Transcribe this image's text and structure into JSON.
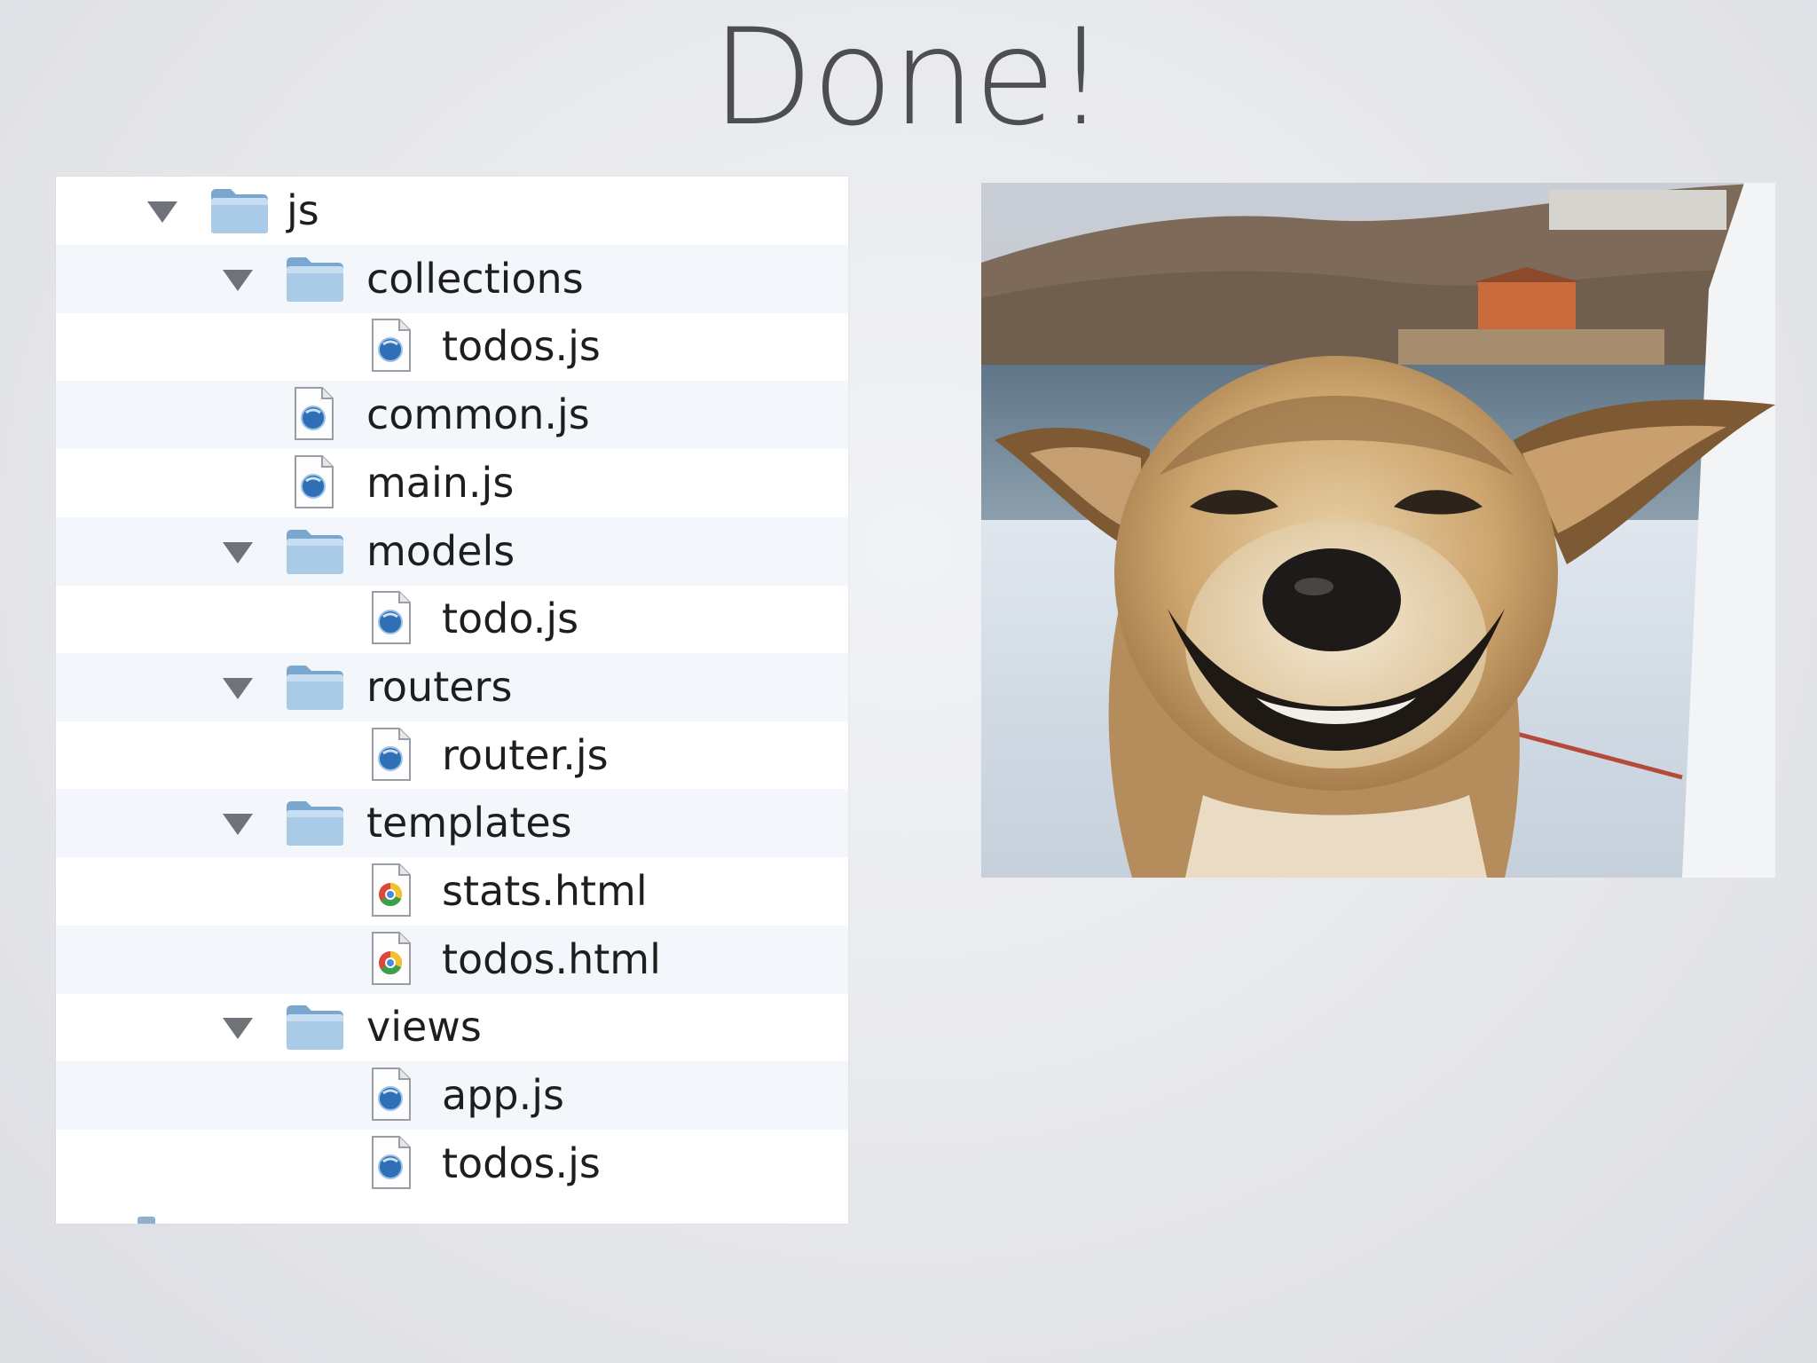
{
  "slide": {
    "title": "Done!"
  },
  "tree": {
    "rows": [
      {
        "label": "js",
        "kind": "folder",
        "level": 0
      },
      {
        "label": "collections",
        "kind": "folder",
        "level": 1
      },
      {
        "label": "todos.js",
        "kind": "js-file",
        "level": 2
      },
      {
        "label": "common.js",
        "kind": "js-file",
        "level": 1
      },
      {
        "label": "main.js",
        "kind": "js-file",
        "level": 1
      },
      {
        "label": "models",
        "kind": "folder",
        "level": 1
      },
      {
        "label": "todo.js",
        "kind": "js-file",
        "level": 2
      },
      {
        "label": "routers",
        "kind": "folder",
        "level": 1
      },
      {
        "label": "router.js",
        "kind": "js-file",
        "level": 2
      },
      {
        "label": "templates",
        "kind": "folder",
        "level": 1
      },
      {
        "label": "stats.html",
        "kind": "html-file",
        "level": 2
      },
      {
        "label": "todos.html",
        "kind": "html-file",
        "level": 2
      },
      {
        "label": "views",
        "kind": "folder",
        "level": 1
      },
      {
        "label": "app.js",
        "kind": "js-file",
        "level": 2
      },
      {
        "label": "todos.js",
        "kind": "js-file",
        "level": 2
      }
    ],
    "icons": {
      "folder": "folder-icon",
      "js-file": "javascript-file-icon",
      "html-file": "html-file-icon",
      "disclosure": "disclosure-triangle-icon"
    }
  },
  "photo": {
    "subject": "smiling-dog-photo"
  }
}
